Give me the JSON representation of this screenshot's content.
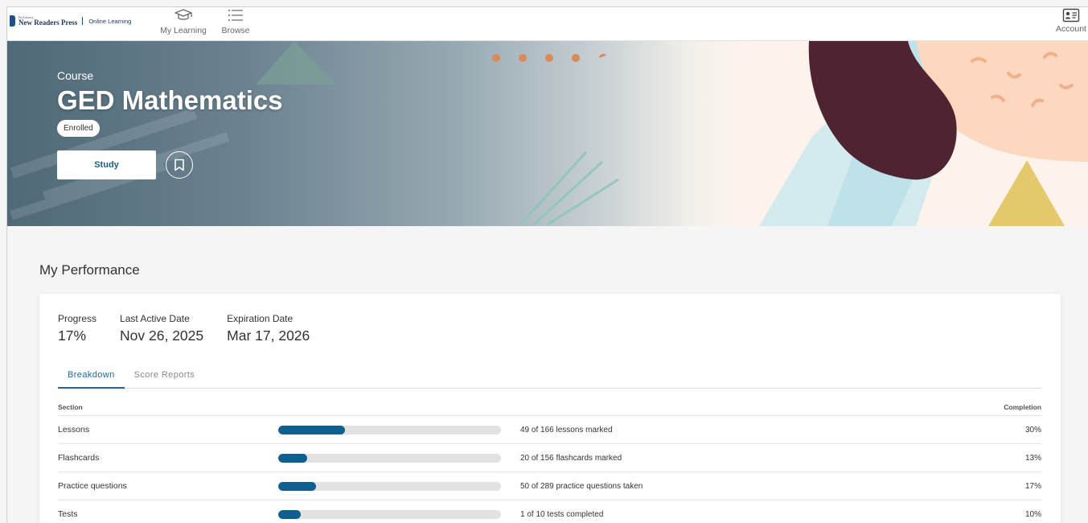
{
  "header": {
    "logo_small": "ProLiteracy",
    "logo_brand": "New Readers Press",
    "logo_sub": "Online Learning",
    "nav": [
      {
        "label": "My Learning",
        "icon": "graduation-cap-icon"
      },
      {
        "label": "Browse",
        "icon": "list-icon"
      }
    ],
    "account": {
      "label": "Account",
      "icon": "id-card-icon"
    }
  },
  "hero": {
    "eyebrow": "Course",
    "title": "GED Mathematics",
    "badge": "Enrolled",
    "study_label": "Study",
    "bookmark_icon": "bookmark-icon"
  },
  "performance": {
    "heading": "My Performance",
    "stats": [
      {
        "label": "Progress",
        "value": "17%"
      },
      {
        "label": "Last Active Date",
        "value": "Nov 26, 2025"
      },
      {
        "label": "Expiration Date",
        "value": "Mar 17, 2026"
      }
    ],
    "tabs": [
      {
        "label": "Breakdown",
        "active": true
      },
      {
        "label": "Score Reports",
        "active": false
      }
    ],
    "table": {
      "col_section": "Section",
      "col_completion": "Completion",
      "rows": [
        {
          "section": "Lessons",
          "detail": "49 of 166 lessons marked",
          "completion": "30%",
          "progress": 0.3
        },
        {
          "section": "Flashcards",
          "detail": "20 of 156 flashcards marked",
          "completion": "13%",
          "progress": 0.13
        },
        {
          "section": "Practice questions",
          "detail": "50 of 289 practice questions taken",
          "completion": "17%",
          "progress": 0.17
        },
        {
          "section": "Tests",
          "detail": "1 of 10 tests completed",
          "completion": "10%",
          "progress": 0.1
        }
      ]
    }
  },
  "colors": {
    "accent": "#0f5f91",
    "tab_active": "#1a6aa0",
    "logo_blue": "#1d4f91",
    "hair": "#4e2432",
    "triangle_yellow": "#e3c96c"
  }
}
